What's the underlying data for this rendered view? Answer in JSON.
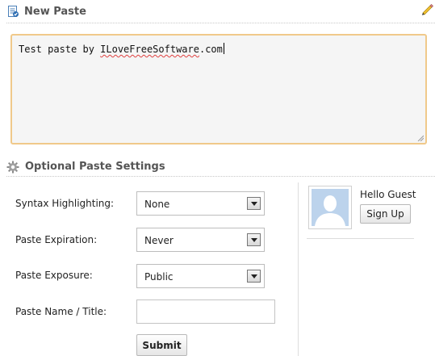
{
  "new_paste": {
    "title": "New Paste",
    "icon": "paste-document-icon",
    "edit_icon": "pencil-icon"
  },
  "paste_content": {
    "text_prefix": "Test paste by ",
    "text_word": "ILoveFreeSoftware",
    "text_suffix": ".com"
  },
  "optional_settings": {
    "title": "Optional Paste Settings",
    "icon": "gear-icon",
    "syntax": {
      "label": "Syntax Highlighting:",
      "value": "None"
    },
    "expiration": {
      "label": "Paste Expiration:",
      "value": "Never"
    },
    "exposure": {
      "label": "Paste Exposure:",
      "value": "Public"
    },
    "name": {
      "label": "Paste Name / Title:",
      "value": ""
    },
    "submit_label": "Submit"
  },
  "user_panel": {
    "greeting": "Hello Guest",
    "signup_label": "Sign Up",
    "avatar_icon": "default-avatar-icon"
  },
  "colors": {
    "textarea_border": "#f0c98a",
    "textarea_bg": "#f5f5f5",
    "avatar_bg": "#bcd3ec"
  }
}
